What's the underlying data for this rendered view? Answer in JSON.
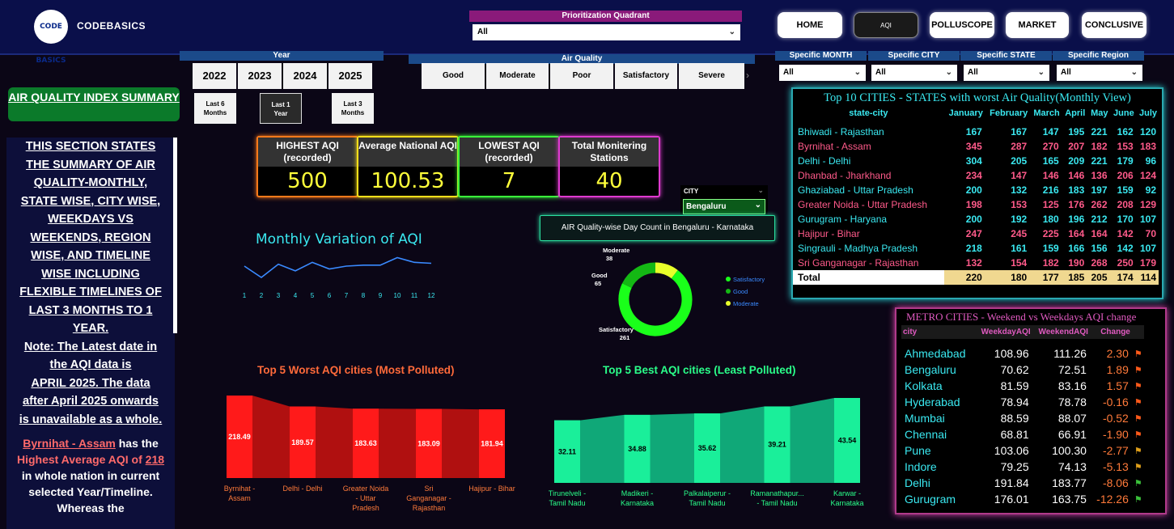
{
  "header": {
    "logo_text": "CODE BASICS",
    "brand": "CODEBASICS",
    "prioritization_label": "Prioritization Quadrant",
    "prioritization_value": "All",
    "nav": [
      "HOME",
      "AQI",
      "POLLUSCOPE",
      "MARKET",
      "CONCLUSIVE"
    ]
  },
  "left": {
    "title": "AIR QUALITY INDEX SUMMARY",
    "summary_lines": [
      "THIS SECTION STATES",
      "THE SUMMARY OF AIR",
      "QUALITY-MONTHLY,",
      "STATE WISE, CITY WISE,",
      "WEEKDAYS VS",
      "WEEKENDS, REGION",
      "WISE, AND TIMELINE",
      "WISE INCLUDING",
      "FLEXIBLE TIMELINES OF",
      "LAST 3 MONTHS TO 1",
      "YEAR."
    ],
    "note_lines": [
      "Note: The Latest date in",
      "the AQI data is",
      "APRIL  2025. The data",
      "after April 2025 onwards",
      "is unavailable as a whole."
    ],
    "highlight_city": "Byrnihat - Assam",
    "highlight_text1": " has the",
    "highlight_text2": "Highest Average AQI of ",
    "highlight_value": "218",
    "highlight_text3": "in whole nation in current",
    "highlight_text4": "selected Year/Timeline.",
    "highlight_text5": "Whereas the"
  },
  "filters": {
    "year_label": "Year",
    "years": [
      "2022",
      "2023",
      "2024",
      "2025"
    ],
    "periods": [
      [
        "Last 6",
        "Months"
      ],
      [
        "Last 1",
        "Year"
      ],
      [
        "Last 3",
        "Months"
      ]
    ],
    "air_quality_label": "Air Quality",
    "air_quality": [
      "Good",
      "Moderate",
      "Poor",
      "Satisfactory",
      "Severe"
    ],
    "dropdowns": [
      {
        "label": "Specific MONTH",
        "value": "All"
      },
      {
        "label": "Specific CITY",
        "value": "All"
      },
      {
        "label": "Specific STATE",
        "value": "All"
      },
      {
        "label": "Specific Region",
        "value": "All"
      }
    ],
    "city_label": "CITY",
    "city_value": "Bengaluru"
  },
  "kpis": [
    {
      "label": "HIGHEST AQI (recorded)",
      "value": "500",
      "color": "#ff7a1a"
    },
    {
      "label": "Average National AQI",
      "value": "100.53",
      "color": "#ffe01a"
    },
    {
      "label": "LOWEST AQI (recorded)",
      "value": "7",
      "color": "#3aff3a"
    },
    {
      "label": "Total Monitering Stations",
      "value": "40",
      "color": "#e03ad0"
    }
  ],
  "monthly_title": "Monthly Variation of AQI",
  "monthly_chart": {
    "type": "line",
    "x": [
      1,
      2,
      3,
      4,
      5,
      6,
      7,
      8,
      9,
      10,
      11,
      12
    ],
    "y": [
      108,
      96,
      110,
      103,
      112,
      105,
      108,
      109,
      109,
      117,
      112,
      111
    ],
    "color": "#3a8aff"
  },
  "donut_title": "AIR Quality-wise Day Count in Bengaluru - Karnataka",
  "donut_chart": {
    "type": "pie",
    "labels": [
      "Satisfactory",
      "Good",
      "Moderate"
    ],
    "values": [
      261,
      65,
      38
    ],
    "colors": [
      "#1aff1a",
      "#14b814",
      "#e8ff2a"
    ]
  },
  "worst_title": "Top 5 Worst AQI cities (Most Polluted)",
  "worst_chart": {
    "type": "bar",
    "categories": [
      "Byrnihat - Assam",
      "Delhi - Delhi",
      "Greater Noida - Uttar Pradesh",
      "Sri Ganganagar - Rajasthan",
      "Hajipur - Bihar"
    ],
    "category_lines": [
      [
        "Byrnihat -",
        "Assam"
      ],
      [
        "Delhi - Delhi"
      ],
      [
        "Greater Noida",
        "- Uttar",
        "Pradesh"
      ],
      [
        "Sri",
        "Ganganagar -",
        "Rajasthan"
      ],
      [
        "Hajipur - Bihar"
      ]
    ],
    "values": [
      218.49,
      189.57,
      183.63,
      183.09,
      181.94
    ],
    "color": "#ff1a1a"
  },
  "best_title": "Top 5 Best AQI cities (Least Polluted)",
  "best_chart": {
    "type": "bar",
    "categories": [
      "Tirunelveli - Tamil Nadu",
      "Madikeri - Karnataka",
      "Palkalaiperur - Tamil Nadu",
      "Ramanathapur... - Tamil Nadu",
      "Karwar - Karnataka"
    ],
    "category_lines": [
      [
        "Tirunelveli -",
        "Tamil Nadu"
      ],
      [
        "Madikeri -",
        "Karnataka"
      ],
      [
        "Palkalaiperur -",
        "Tamil Nadu"
      ],
      [
        "Ramanathapur...",
        "- Tamil Nadu"
      ],
      [
        "Karwar -",
        "Karnataka"
      ]
    ],
    "values": [
      32.11,
      34.88,
      35.62,
      39.21,
      43.54
    ],
    "color": "#1aef9a"
  },
  "top10": {
    "title": "Top 10 CITIES - STATES with worst Air Quality(Monthly View)",
    "columns": [
      "state-city",
      "January",
      "February",
      "March",
      "April",
      "May",
      "June",
      "July"
    ],
    "rows": [
      {
        "name": "Bhiwadi - Rajasthan",
        "vals": [
          "167",
          "167",
          "147",
          "195",
          "221",
          "162",
          "120"
        ]
      },
      {
        "name": "Byrnihat - Assam",
        "vals": [
          "345",
          "287",
          "270",
          "207",
          "182",
          "153",
          "183"
        ]
      },
      {
        "name": "Delhi - Delhi",
        "vals": [
          "304",
          "205",
          "165",
          "209",
          "221",
          "179",
          "96"
        ]
      },
      {
        "name": "Dhanbad - Jharkhand",
        "vals": [
          "234",
          "147",
          "146",
          "146",
          "136",
          "206",
          "124"
        ]
      },
      {
        "name": "Ghaziabad - Uttar Pradesh",
        "vals": [
          "200",
          "132",
          "216",
          "183",
          "197",
          "159",
          "92"
        ]
      },
      {
        "name": "Greater Noida - Uttar Pradesh",
        "vals": [
          "198",
          "153",
          "125",
          "176",
          "262",
          "208",
          "129"
        ]
      },
      {
        "name": "Gurugram - Haryana",
        "vals": [
          "200",
          "192",
          "180",
          "196",
          "212",
          "170",
          "107"
        ]
      },
      {
        "name": "Hajipur - Bihar",
        "vals": [
          "247",
          "245",
          "225",
          "164",
          "164",
          "142",
          "70"
        ]
      },
      {
        "name": "Singrauli - Madhya Pradesh",
        "vals": [
          "218",
          "161",
          "159",
          "166",
          "156",
          "142",
          "107"
        ]
      },
      {
        "name": "Sri Ganganagar - Rajasthan",
        "vals": [
          "132",
          "154",
          "182",
          "190",
          "268",
          "250",
          "179"
        ]
      }
    ],
    "total_label": "Total",
    "total": [
      "220",
      "180",
      "177",
      "185",
      "205",
      "174",
      "114"
    ]
  },
  "metro": {
    "title": "METRO CITIES - Weekend vs Weekdays AQI change",
    "columns": [
      "city",
      "WeekdayAQI",
      "WeekendAQI",
      "Change"
    ],
    "rows": [
      {
        "city": "Ahmedabad",
        "wd": "108.96",
        "we": "111.26",
        "ch": "2.30",
        "flag": "#ff5a1a"
      },
      {
        "city": "Bengaluru",
        "wd": "70.62",
        "we": "72.51",
        "ch": "1.89",
        "flag": "#ff5a1a"
      },
      {
        "city": "Kolkata",
        "wd": "81.59",
        "we": "83.16",
        "ch": "1.57",
        "flag": "#ff5a1a"
      },
      {
        "city": "Hyderabad",
        "wd": "78.94",
        "we": "78.78",
        "ch": "-0.16",
        "flag": "#ff5a1a"
      },
      {
        "city": "Mumbai",
        "wd": "88.59",
        "we": "88.07",
        "ch": "-0.52",
        "flag": "#ff5a1a"
      },
      {
        "city": "Chennai",
        "wd": "68.81",
        "we": "66.91",
        "ch": "-1.90",
        "flag": "#ff5a1a"
      },
      {
        "city": "Pune",
        "wd": "103.06",
        "we": "100.30",
        "ch": "-2.77",
        "flag": "#e0a01a"
      },
      {
        "city": "Indore",
        "wd": "79.25",
        "we": "74.13",
        "ch": "-5.13",
        "flag": "#e0a01a"
      },
      {
        "city": "Delhi",
        "wd": "191.84",
        "we": "183.77",
        "ch": "-8.06",
        "flag": "#3ac03a"
      },
      {
        "city": "Gurugram",
        "wd": "176.01",
        "we": "163.75",
        "ch": "-12.26",
        "flag": "#3ac03a"
      }
    ]
  }
}
